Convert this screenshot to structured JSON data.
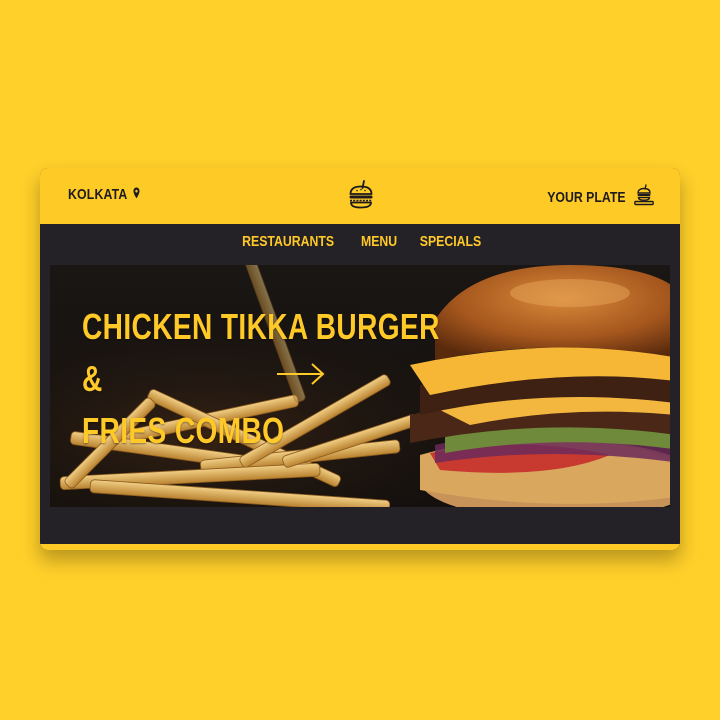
{
  "header": {
    "location": "KOLKATA",
    "location_icon": "map-pin-icon",
    "logo_icon": "burger-logo-icon",
    "plate_label": "YOUR PLATE",
    "plate_icon": "food-tray-icon"
  },
  "nav": {
    "items": [
      {
        "label": "RESTAURANTS"
      },
      {
        "label": "MENU"
      },
      {
        "label": "SPECIALS"
      }
    ]
  },
  "hero": {
    "headline_line1": "CHICKEN TIKKA BURGER &",
    "headline_line2": "FRIES COMBO",
    "arrow_icon": "arrow-right-icon"
  },
  "colors": {
    "accent": "#FFC928",
    "background": "#FFCF2A",
    "dark": "#242226"
  }
}
